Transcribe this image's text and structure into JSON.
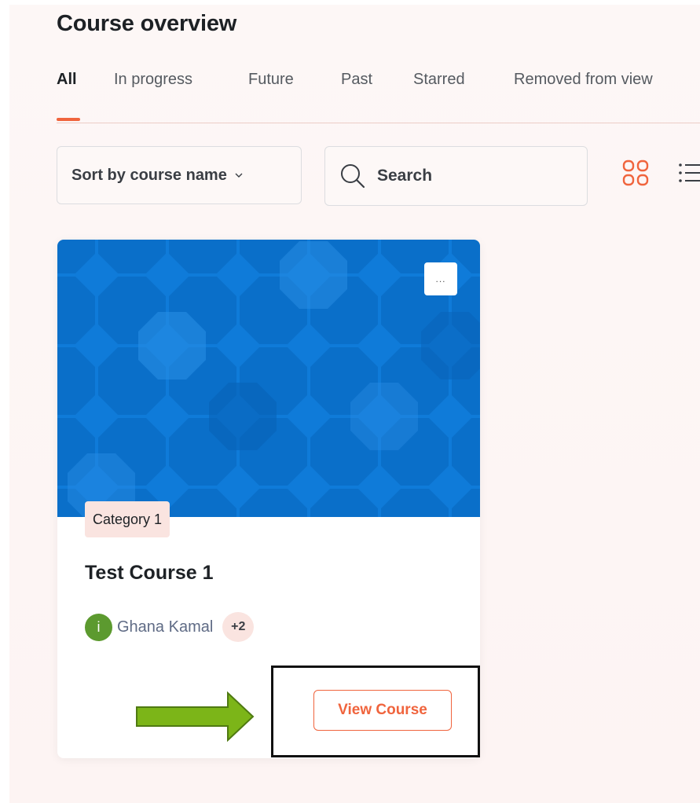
{
  "page": {
    "title": "Course overview"
  },
  "tabs": [
    {
      "label": "All",
      "active": true
    },
    {
      "label": "In progress",
      "active": false
    },
    {
      "label": "Future",
      "active": false
    },
    {
      "label": "Past",
      "active": false
    },
    {
      "label": "Starred",
      "active": false
    },
    {
      "label": "Removed from view",
      "active": false
    }
  ],
  "toolbar": {
    "sort_label": "Sort by course name",
    "sort_icon": "chevron-down-icon",
    "search_placeholder": "Search",
    "search_icon": "search-icon",
    "view_icons": [
      "grid-view-icon",
      "list-view-icon"
    ]
  },
  "course_card": {
    "menu_label": "...",
    "category": "Category 1",
    "name": "Test Course 1",
    "teacher_initial": "i",
    "teacher_name": "Ghana Kamal",
    "more_teachers": "+2",
    "view_button": "View Course"
  },
  "colors": {
    "accent": "#f0643d",
    "card_image_blue": "#0e7ad8",
    "avatar_green": "#5c9a2f",
    "arrow_green": "#7cb518",
    "badge_bg": "#fae4e0"
  }
}
